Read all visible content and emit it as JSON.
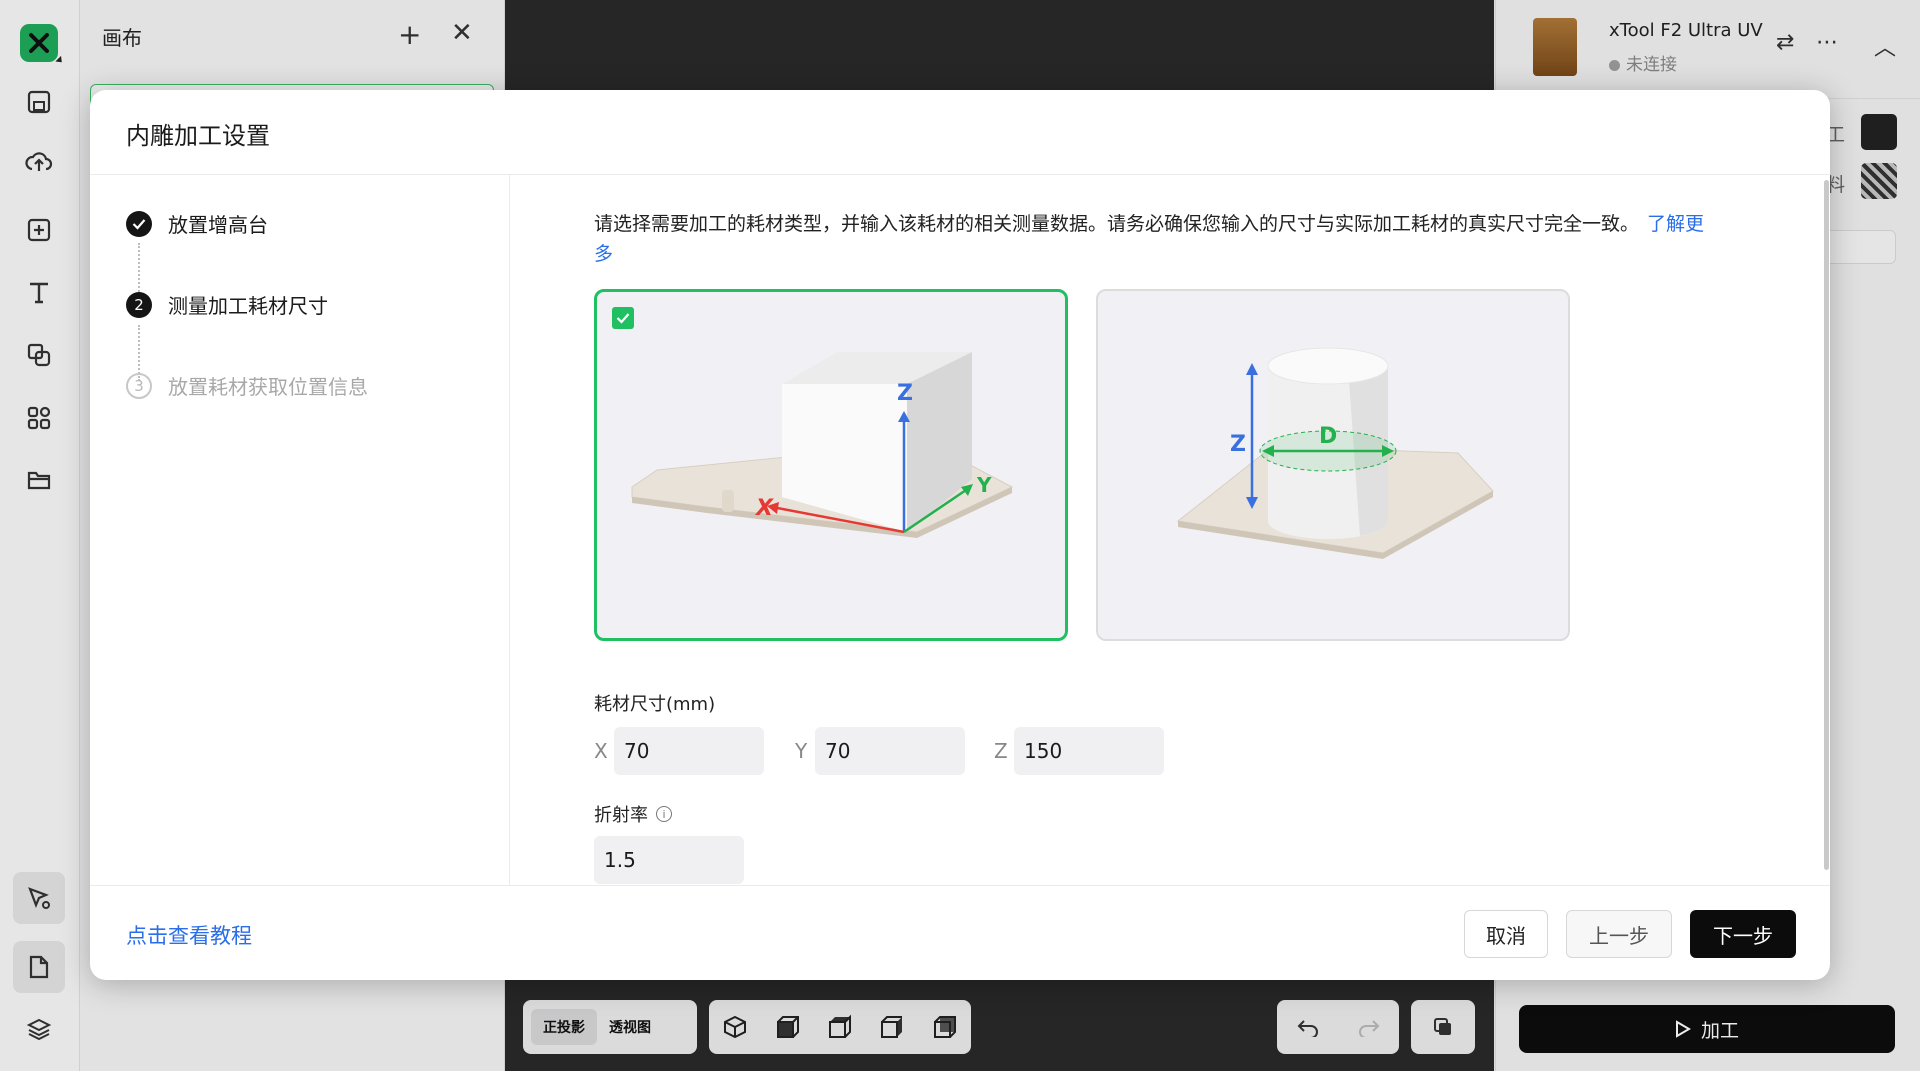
{
  "left_panel": {
    "title": "画布"
  },
  "device": {
    "name": "xTool F2 Ultra UV",
    "status": "未连接"
  },
  "right_panel": {
    "cut_labels": [
      "工",
      "料"
    ]
  },
  "bottom_toolbar": {
    "view_ortho": "正投影",
    "view_persp": "透视图",
    "process_label": "加工"
  },
  "modal": {
    "title": "内雕加工设置",
    "steps": [
      {
        "label": "放置增高台",
        "state": "done"
      },
      {
        "label": "测量加工耗材尺寸",
        "state": "current",
        "number": "2"
      },
      {
        "label": "放置耗材获取位置信息",
        "state": "pending",
        "number": "3"
      }
    ],
    "description": "请选择需要加工的耗材类型，并输入该耗材的相关测量数据。请务必确保您输入的尺寸与实际加工耗材的真实尺寸完全一致。",
    "learn_more": "了解更多",
    "shape_options": [
      {
        "name": "cuboid",
        "selected": true,
        "axis_labels": [
          "X",
          "Y",
          "Z"
        ]
      },
      {
        "name": "cylinder",
        "selected": false,
        "axis_labels": [
          "Z",
          "D"
        ]
      }
    ],
    "size_label": "耗材尺寸(mm)",
    "fields": [
      {
        "axis": "X",
        "value": "70"
      },
      {
        "axis": "Y",
        "value": "70"
      },
      {
        "axis": "Z",
        "value": "150"
      }
    ],
    "refraction_label": "折射率",
    "refraction_value": "1.5",
    "tutorial_link": "点击查看教程",
    "buttons": {
      "cancel": "取消",
      "prev": "上一步",
      "next": "下一步"
    }
  },
  "colors": {
    "accent_green": "#20bf61",
    "link_blue": "#2a6ee9",
    "x_axis": "#e53935",
    "y_axis": "#22b14c",
    "z_axis": "#3a6fe0"
  }
}
